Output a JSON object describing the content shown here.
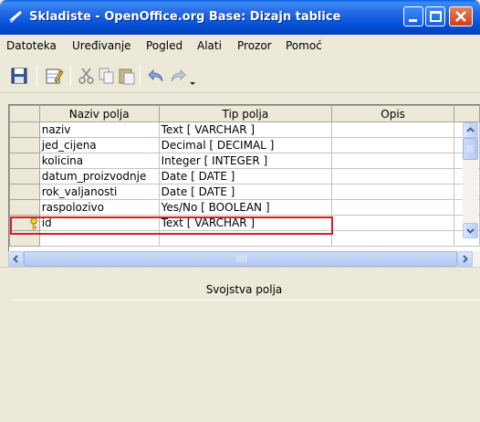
{
  "window": {
    "title": "Skladiste - OpenOffice.org Base: Dizajn tablice"
  },
  "menu": [
    {
      "label": "Datoteka"
    },
    {
      "label": "Uređivanje"
    },
    {
      "label": "Pogled"
    },
    {
      "label": "Alati"
    },
    {
      "label": "Prozor"
    },
    {
      "label": "Pomoć"
    }
  ],
  "toolbar": {
    "icons": [
      "save-icon",
      "edit-table-icon",
      "cut-icon",
      "copy-icon",
      "paste-icon",
      "undo-icon",
      "redo-icon",
      "toolbar-dropdown-icon"
    ]
  },
  "grid": {
    "columns": [
      "Naziv polja",
      "Tip polja",
      "Opis"
    ],
    "rows": [
      {
        "name": "naziv",
        "type": "Text [ VARCHAR ]",
        "desc": "",
        "key": false
      },
      {
        "name": "jed_cijena",
        "type": "Decimal [ DECIMAL ]",
        "desc": "",
        "key": false
      },
      {
        "name": "kolicina",
        "type": "Integer [ INTEGER ]",
        "desc": "",
        "key": false
      },
      {
        "name": "datum_proizvodnje",
        "type": "Date [ DATE ]",
        "desc": "",
        "key": false
      },
      {
        "name": "rok_valjanosti",
        "type": "Date [ DATE ]",
        "desc": "",
        "key": false
      },
      {
        "name": "raspolozivo",
        "type": "Yes/No [ BOOLEAN ]",
        "desc": "",
        "key": false
      },
      {
        "name": "id",
        "type": "Text [ VARCHAR ]",
        "desc": "",
        "key": true
      },
      {
        "name": "",
        "type": "",
        "desc": "",
        "key": false
      }
    ]
  },
  "properties": {
    "title": "Svojstva polja"
  },
  "colors": {
    "highlight": "#e0192b",
    "titlebar": "#0552d9"
  }
}
